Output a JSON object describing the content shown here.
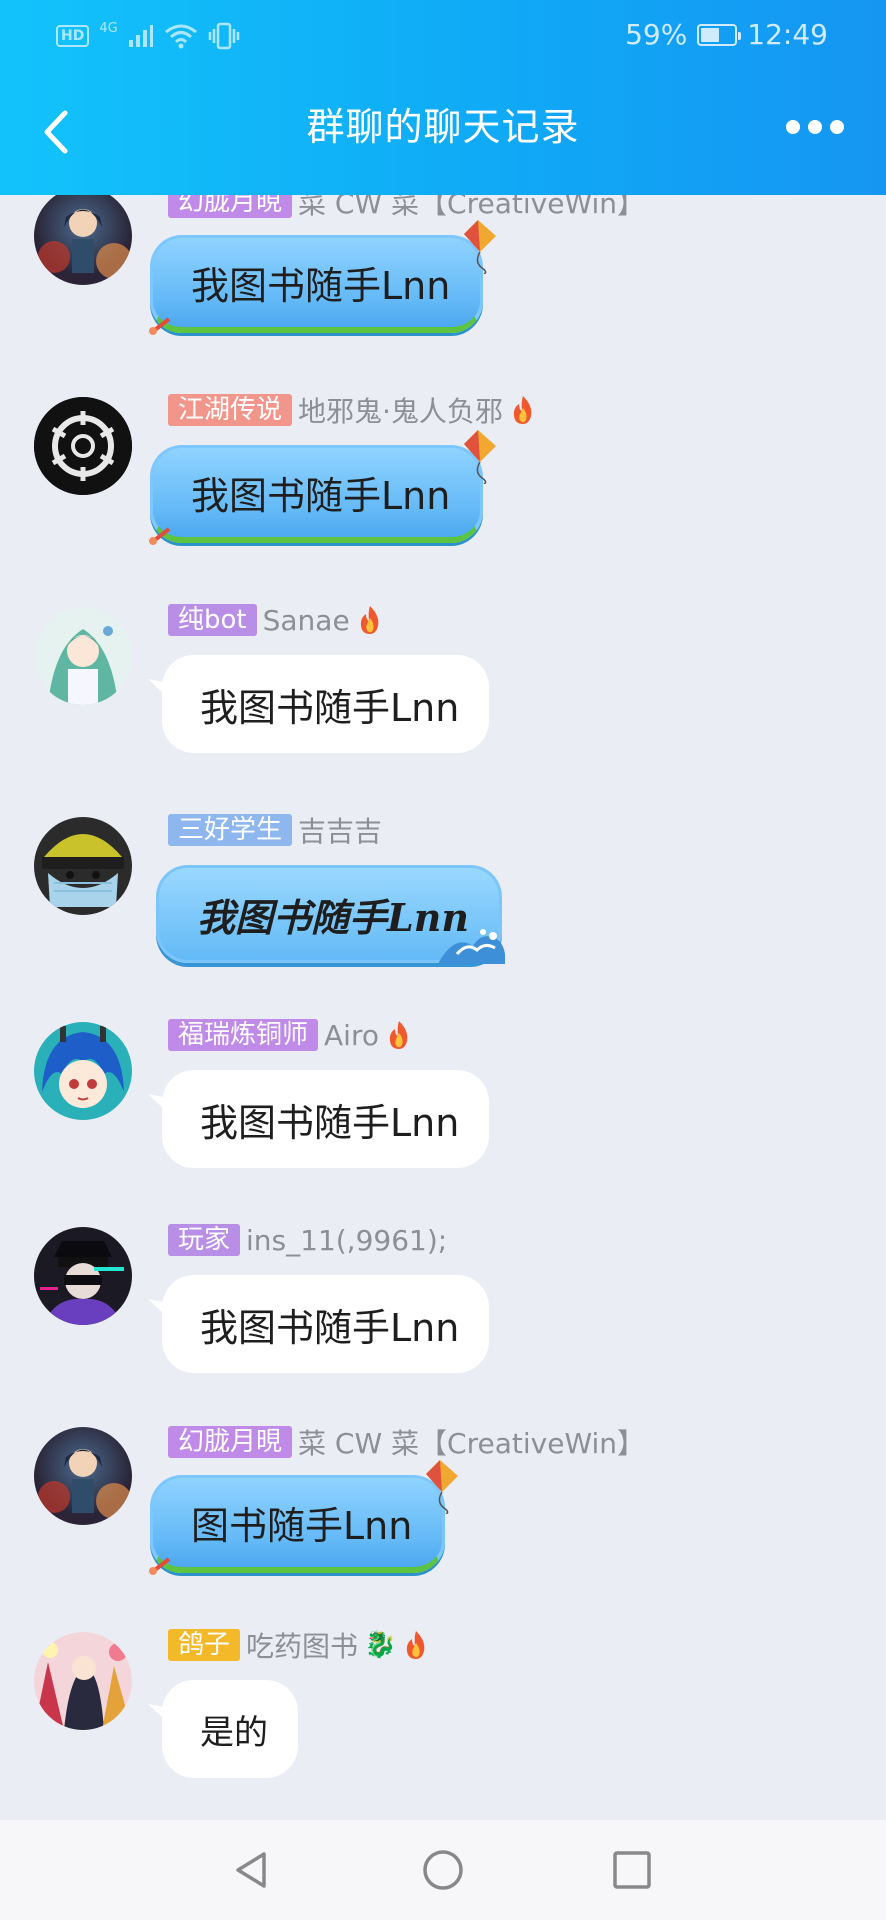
{
  "status_bar": {
    "hd": "HD",
    "network": "4G",
    "battery_percent": "59%",
    "battery_level": 0.59,
    "time": "12:49"
  },
  "header": {
    "title": "群聊的聊天记录",
    "back_icon": "chevron-left-icon",
    "more_icon": "more-dots-icon"
  },
  "messages": [
    {
      "badge": "幻胧月晛",
      "badge_color": "#c08ae8",
      "nick": "菜 CW 菜【CreativeWin】",
      "text": "我图书随手Lnn",
      "style": "kite",
      "fire": false
    },
    {
      "badge": "江湖传说",
      "badge_color": "#f2958a",
      "nick": "地邪鬼·鬼人负邪",
      "text": "我图书随手Lnn",
      "style": "kite",
      "fire": true
    },
    {
      "badge": "纯bot",
      "badge_color": "#b98ee6",
      "nick": "Sanae",
      "text": "我图书随手Lnn",
      "style": "plain",
      "fire": true
    },
    {
      "badge": "三好学生",
      "badge_color": "#8eb7ef",
      "nick": "吉吉吉",
      "text": "我图书随手Lnn",
      "style": "wave",
      "fire": false
    },
    {
      "badge": "福瑞炼铜师",
      "badge_color": "#c08ae8",
      "nick": "Airo",
      "text": "我图书随手Lnn",
      "style": "plain",
      "fire": true
    },
    {
      "badge": "玩家",
      "badge_color": "#b98ee6",
      "nick": "ins_11(,9961);",
      "text": "我图书随手Lnn",
      "style": "plain",
      "fire": false
    },
    {
      "badge": "幻胧月晛",
      "badge_color": "#c08ae8",
      "nick": "菜 CW 菜【CreativeWin】",
      "text": "图书随手Lnn",
      "style": "kite",
      "fire": false
    },
    {
      "badge": "鸽子",
      "badge_color": "#f3b928",
      "nick": "吃药图书",
      "text": "是的",
      "style": "hand",
      "fire": true,
      "extra_emoji": "🐉"
    }
  ],
  "navbar": {
    "back_icon": "triangle-back-icon",
    "home_icon": "circle-home-icon",
    "recents_icon": "square-recents-icon"
  }
}
